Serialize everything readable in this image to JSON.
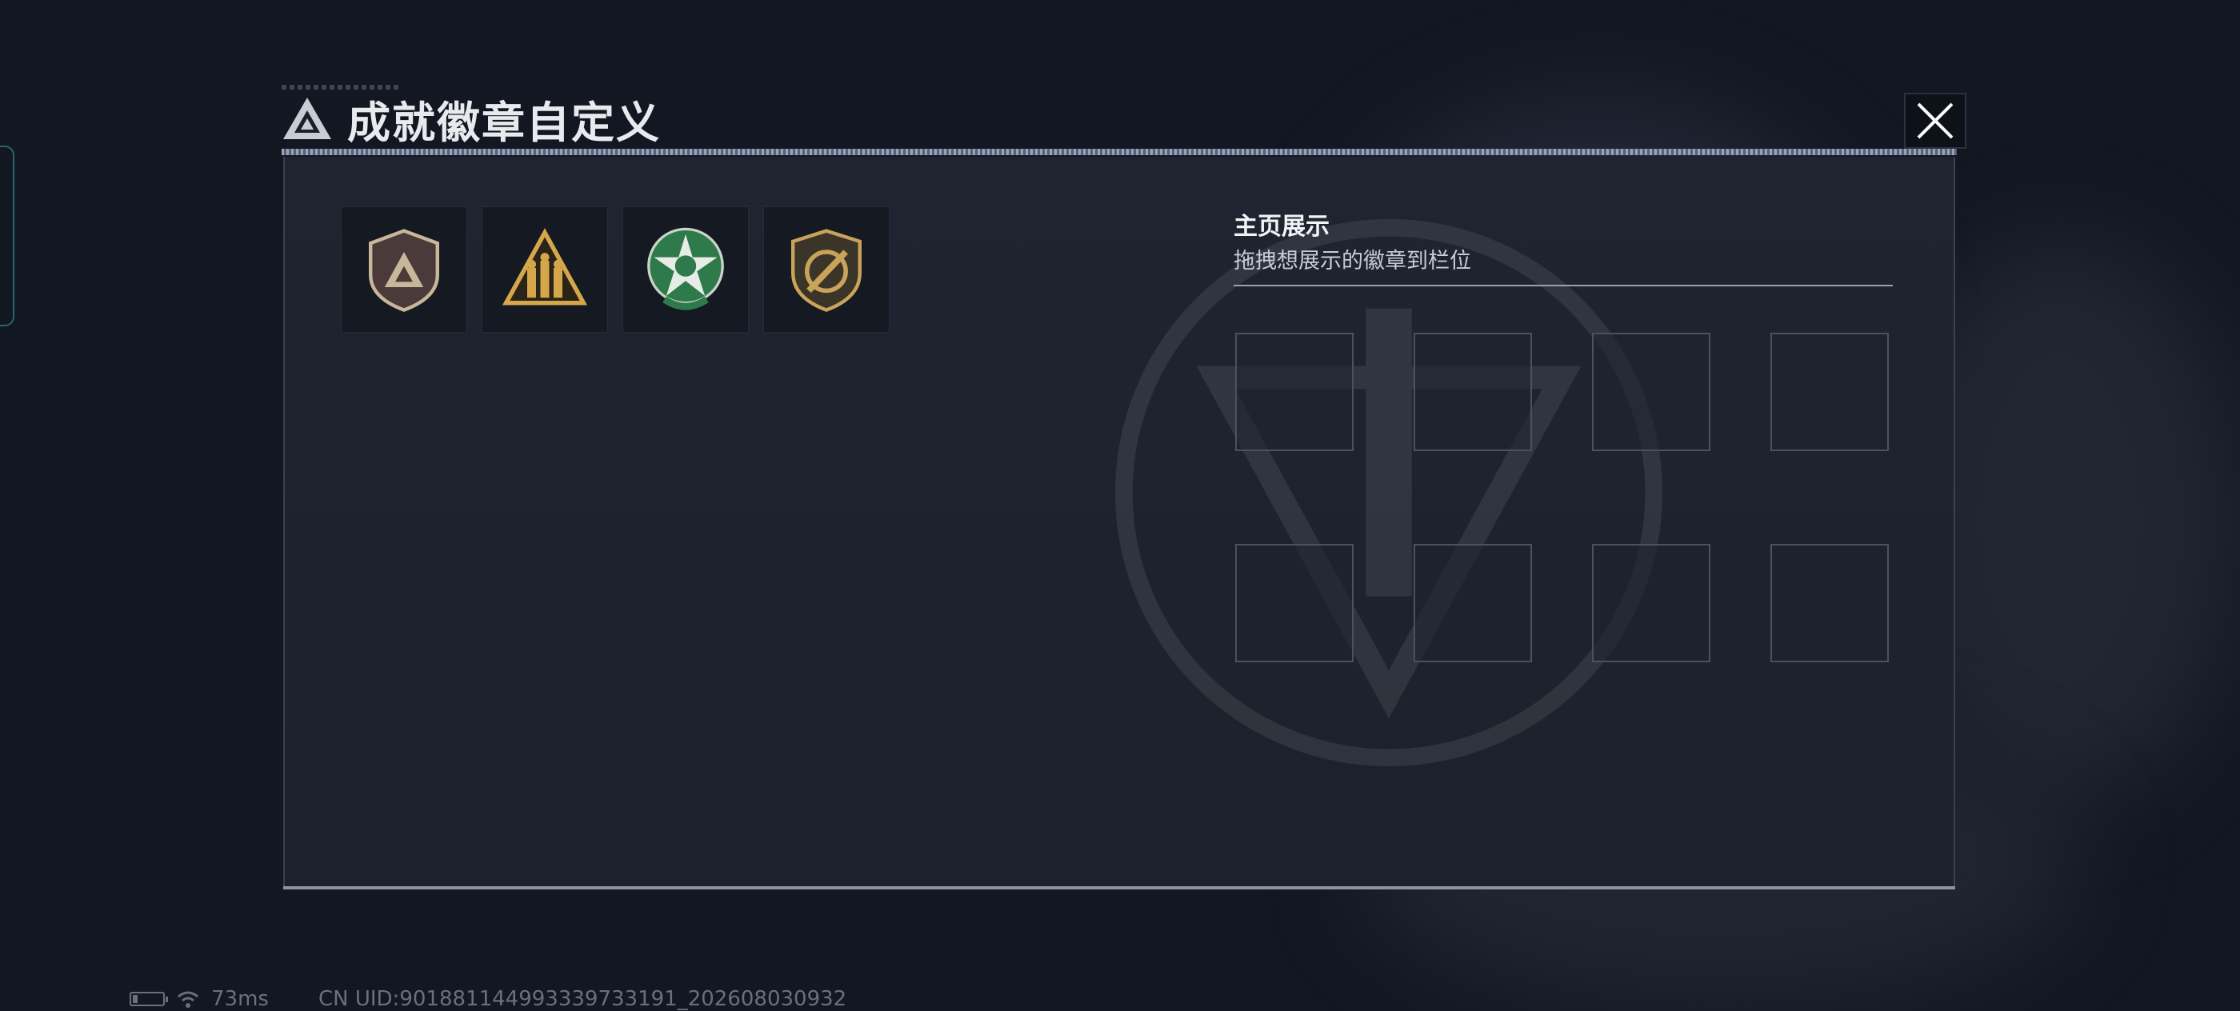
{
  "header": {
    "title": "成就徽章自定义",
    "close_icon": "close-x-icon"
  },
  "badges": [
    {
      "name": "shield-triangle-badge",
      "color": "#c8b79a"
    },
    {
      "name": "soldiers-triangle-badge",
      "color": "#d6a74a"
    },
    {
      "name": "green-star-badge",
      "color": "#2f7a4a"
    },
    {
      "name": "shield-knife-badge",
      "color": "#c9a35a"
    }
  ],
  "showcase": {
    "title": "主页展示",
    "subtitle": "拖拽想展示的徽章到栏位",
    "slot_count": 8
  },
  "footer": {
    "battery_icon": "battery-icon",
    "wifi_icon": "wifi-icon",
    "ping": "73ms",
    "uid": "CN UID:901881144993339733191_202608030932"
  },
  "colors": {
    "accent": "#d6a74a",
    "panel": "#1f2430",
    "background": "#121722"
  }
}
